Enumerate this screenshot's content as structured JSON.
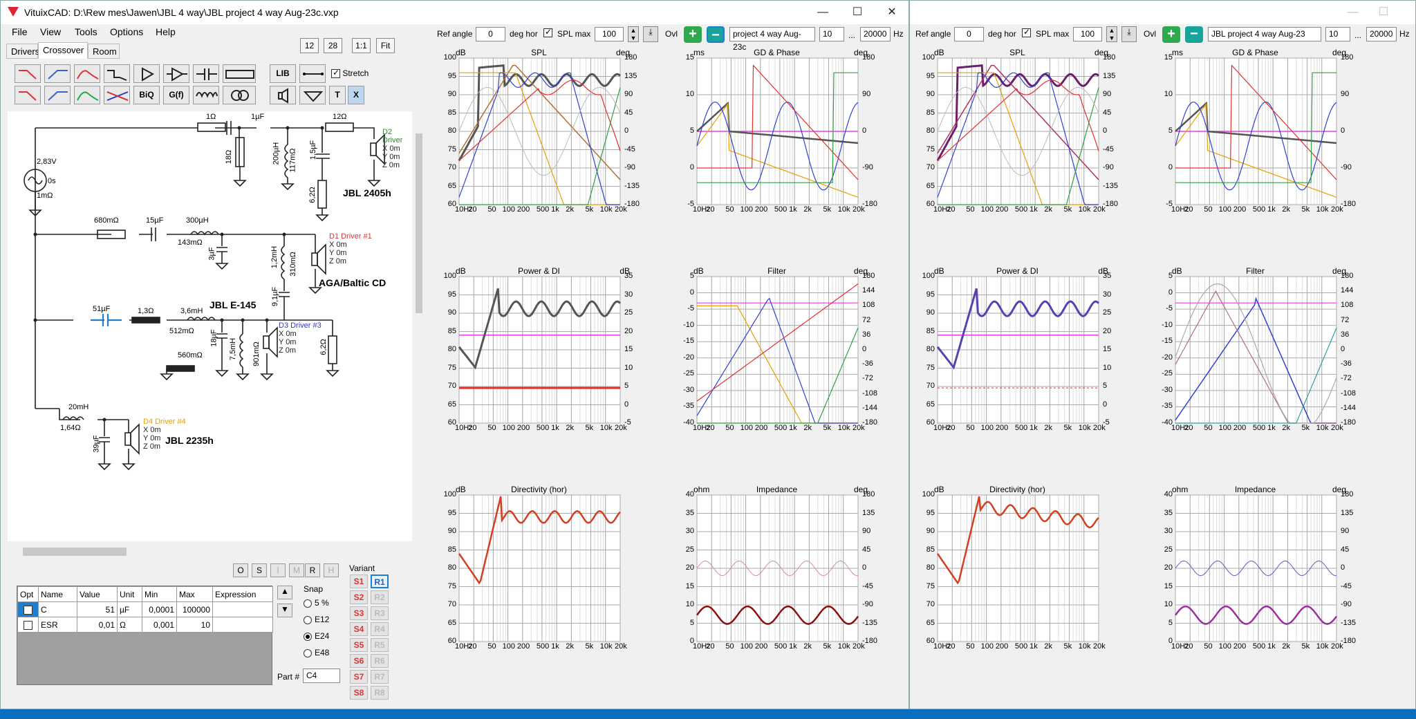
{
  "window1": {
    "title": "VituixCAD: D:\\Rew mes\\Jawen\\JBL 4 way\\JBL project 4 way Aug-23c.vxp"
  },
  "menu": [
    "File",
    "View",
    "Tools",
    "Options",
    "Help"
  ],
  "tabs": [
    "Drivers",
    "Crossover",
    "Room"
  ],
  "zoom": {
    "a": "12",
    "b": "28",
    "c": "1:1",
    "d": "Fit"
  },
  "toolbar": {
    "lib": "LIB",
    "stretch": "Stretch",
    "biq": "BiQ",
    "gf": "G(f)",
    "t": "T",
    "x": "X"
  },
  "schematic": {
    "source": {
      "v": "2,83V",
      "phase": "0s",
      "r": "1mΩ"
    },
    "d2": {
      "name": "D2 Driver",
      "x": "X 0m",
      "y": "Y 0m",
      "z": "Z 0m",
      "model": "JBL 2405h",
      "r1": "1Ω",
      "c1": "1µF",
      "r2": "12Ω",
      "r3": "18Ω",
      "l1": "200µH",
      "l1r": "117mΩ",
      "c2": "1,5µF",
      "r4": "6,2Ω"
    },
    "d1": {
      "name": "D1 Driver #1",
      "x": "X 0m",
      "y": "Y 0m",
      "z": "Z 0m",
      "model": "AGA/Baltic CD",
      "r1": "680mΩ",
      "c1": "15µF",
      "l1": "300µH",
      "l1r": "143mΩ",
      "c2": "3µF",
      "l2": "1,2mH",
      "l2r": "310mΩ",
      "c3": "9,1µF"
    },
    "d3": {
      "name": "D3 Driver #3",
      "x": "X 0m",
      "y": "Y 0m",
      "z": "Z 0m",
      "model": "JBL E-145",
      "c1": "51µF",
      "r1": "1,3Ω",
      "l1": "3,6mH",
      "l1r": "512mΩ",
      "c2": "18µF",
      "l2": "7,5mH",
      "l2r": "901mΩ",
      "r2": "560mΩ",
      "r3": "6,2Ω"
    },
    "d4": {
      "name": "D4 Driver #4",
      "x": "X 0m",
      "y": "Y 0m",
      "z": "Z 0m",
      "model": "JBL 2235h",
      "l1": "20mH",
      "l1r": "1,64Ω",
      "c1": "39µF"
    }
  },
  "smallbtns": [
    "O",
    "S",
    "I",
    "M",
    "R",
    "H"
  ],
  "table": {
    "headers": [
      "Opt",
      "Name",
      "Value",
      "Unit",
      "Min",
      "Max",
      "Expression"
    ],
    "rows": [
      {
        "name": "C",
        "value": "51",
        "unit": "µF",
        "min": "0,0001",
        "max": "100000",
        "expr": ""
      },
      {
        "name": "ESR",
        "value": "0,01",
        "unit": "Ω",
        "min": "0,001",
        "max": "10",
        "expr": ""
      }
    ]
  },
  "snap": {
    "title": "Snap",
    "options": [
      "5 %",
      "E12",
      "E24",
      "E48"
    ],
    "selected": "E24",
    "part_label": "Part #",
    "part_value": "C4"
  },
  "variant": {
    "title": "Variant",
    "s": [
      "S1",
      "S2",
      "S3",
      "S4",
      "S5",
      "S6",
      "S7",
      "S8"
    ],
    "r": [
      "R1",
      "R2",
      "R3",
      "R4",
      "R5",
      "R6",
      "R7",
      "R8"
    ]
  },
  "controls1": {
    "ref_angle_label": "Ref angle",
    "ref_angle": "0",
    "deg_hor": "deg hor",
    "spl_max_label": "SPL max",
    "spl_max": "100",
    "ovl": "Ovl",
    "project": "project 4 way Aug-23c",
    "fmin": "10",
    "dots": "...",
    "fmax": "20000",
    "hz": "Hz"
  },
  "controls2": {
    "ref_angle_label": "Ref angle",
    "ref_angle": "0",
    "deg_hor": "deg hor",
    "spl_max_label": "SPL max",
    "spl_max": "100",
    "ovl": "Ovl",
    "project": "JBL project 4 way Aug-23",
    "fmin": "10",
    "dots": "...",
    "fmax": "20000",
    "hz": "Hz"
  },
  "freq_ticks": [
    "10Hz",
    "20",
    "50",
    "100",
    "200",
    "500",
    "1k",
    "2k",
    "5k",
    "10k",
    "20k"
  ],
  "panel_titles": {
    "spl": "SPL",
    "gd": "GD & Phase",
    "power": "Power & DI",
    "filter": "Filter",
    "dir": "Directivity (hor)",
    "imp": "Impedance"
  },
  "axes": {
    "spl": {
      "l": "dB",
      "r": "deg",
      "left": [
        "100",
        "95",
        "90",
        "85",
        "80",
        "75",
        "70",
        "65",
        "60"
      ],
      "right": [
        "180",
        "135",
        "90",
        "45",
        "0",
        "-45",
        "-90",
        "-135",
        "-180"
      ]
    },
    "gd": {
      "l": "ms",
      "r": "deg",
      "left": [
        "15",
        "10",
        "5",
        "0",
        "-5"
      ],
      "right": [
        "180",
        "90",
        "0",
        "-90",
        "-180"
      ]
    },
    "power": {
      "l": "dB",
      "r": "dB",
      "left": [
        "100",
        "95",
        "90",
        "85",
        "80",
        "75",
        "70",
        "65",
        "60"
      ],
      "right": [
        "35",
        "30",
        "25",
        "20",
        "15",
        "10",
        "5",
        "0",
        "-5"
      ]
    },
    "filter": {
      "l": "dB",
      "r": "deg",
      "left": [
        "5",
        "0",
        "-5",
        "-10",
        "-15",
        "-20",
        "-25",
        "-30",
        "-35",
        "-40"
      ],
      "right": [
        "180",
        "144",
        "108",
        "72",
        "36",
        "0",
        "-36",
        "-72",
        "-108",
        "-144",
        "-180"
      ]
    },
    "dir": {
      "l": "dB",
      "r": "",
      "left": [
        "100",
        "95",
        "90",
        "85",
        "80",
        "75",
        "70",
        "65",
        "60"
      ],
      "right": []
    },
    "imp": {
      "l": "ohm",
      "r": "deg",
      "left": [
        "40",
        "35",
        "30",
        "25",
        "20",
        "15",
        "10",
        "5",
        "0"
      ],
      "right": [
        "180",
        "135",
        "90",
        "45",
        "0",
        "-45",
        "-90",
        "-135",
        "-180"
      ]
    }
  },
  "colors": {
    "accent": "#1e7fd0",
    "green_btn": "#2fa84f",
    "teal_btn": "#1aa39a"
  }
}
